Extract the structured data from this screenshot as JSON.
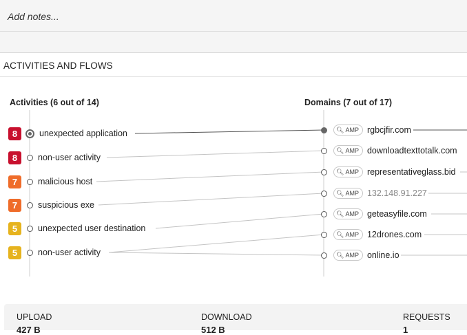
{
  "notes": {
    "placeholder": "Add notes..."
  },
  "section": {
    "title": "ACTIVITIES AND FLOWS"
  },
  "activities": {
    "header": "Activities (6 out of 14)",
    "items": [
      {
        "score": "8",
        "label": "unexpected application",
        "color": "#c8102e",
        "selected": true
      },
      {
        "score": "8",
        "label": "non-user activity",
        "color": "#c8102e",
        "selected": false
      },
      {
        "score": "7",
        "label": "malicious host",
        "color": "#ef6c2a",
        "selected": false
      },
      {
        "score": "7",
        "label": "suspicious exe",
        "color": "#ef6c2a",
        "selected": false
      },
      {
        "score": "5",
        "label": "unexpected user destination",
        "color": "#e6b31e",
        "selected": false
      },
      {
        "score": "5",
        "label": "non-user activity",
        "color": "#e6b31e",
        "selected": false
      }
    ]
  },
  "domains": {
    "header": "Domains (7 out of 17)",
    "amp_label": "AMP",
    "items": [
      {
        "label": "rgbcjfir.com",
        "selected": true,
        "dim": false
      },
      {
        "label": "downloadtexttotalk.com",
        "selected": false,
        "dim": false
      },
      {
        "label": "representativeglass.bid",
        "selected": false,
        "dim": false
      },
      {
        "label": "132.148.91.227",
        "selected": false,
        "dim": true
      },
      {
        "label": "geteasyfile.com",
        "selected": false,
        "dim": false
      },
      {
        "label": "12drones.com",
        "selected": false,
        "dim": false
      },
      {
        "label": "online.io",
        "selected": false,
        "dim": false
      }
    ]
  },
  "stats": {
    "upload_label": "UPLOAD",
    "upload_value": "427 B",
    "download_label": "DOWNLOAD",
    "download_value": "512 B",
    "requests_label": "REQUESTS",
    "requests_value": "1"
  },
  "colors": {
    "line": "#bfbfbf",
    "line_selected": "#555555"
  }
}
